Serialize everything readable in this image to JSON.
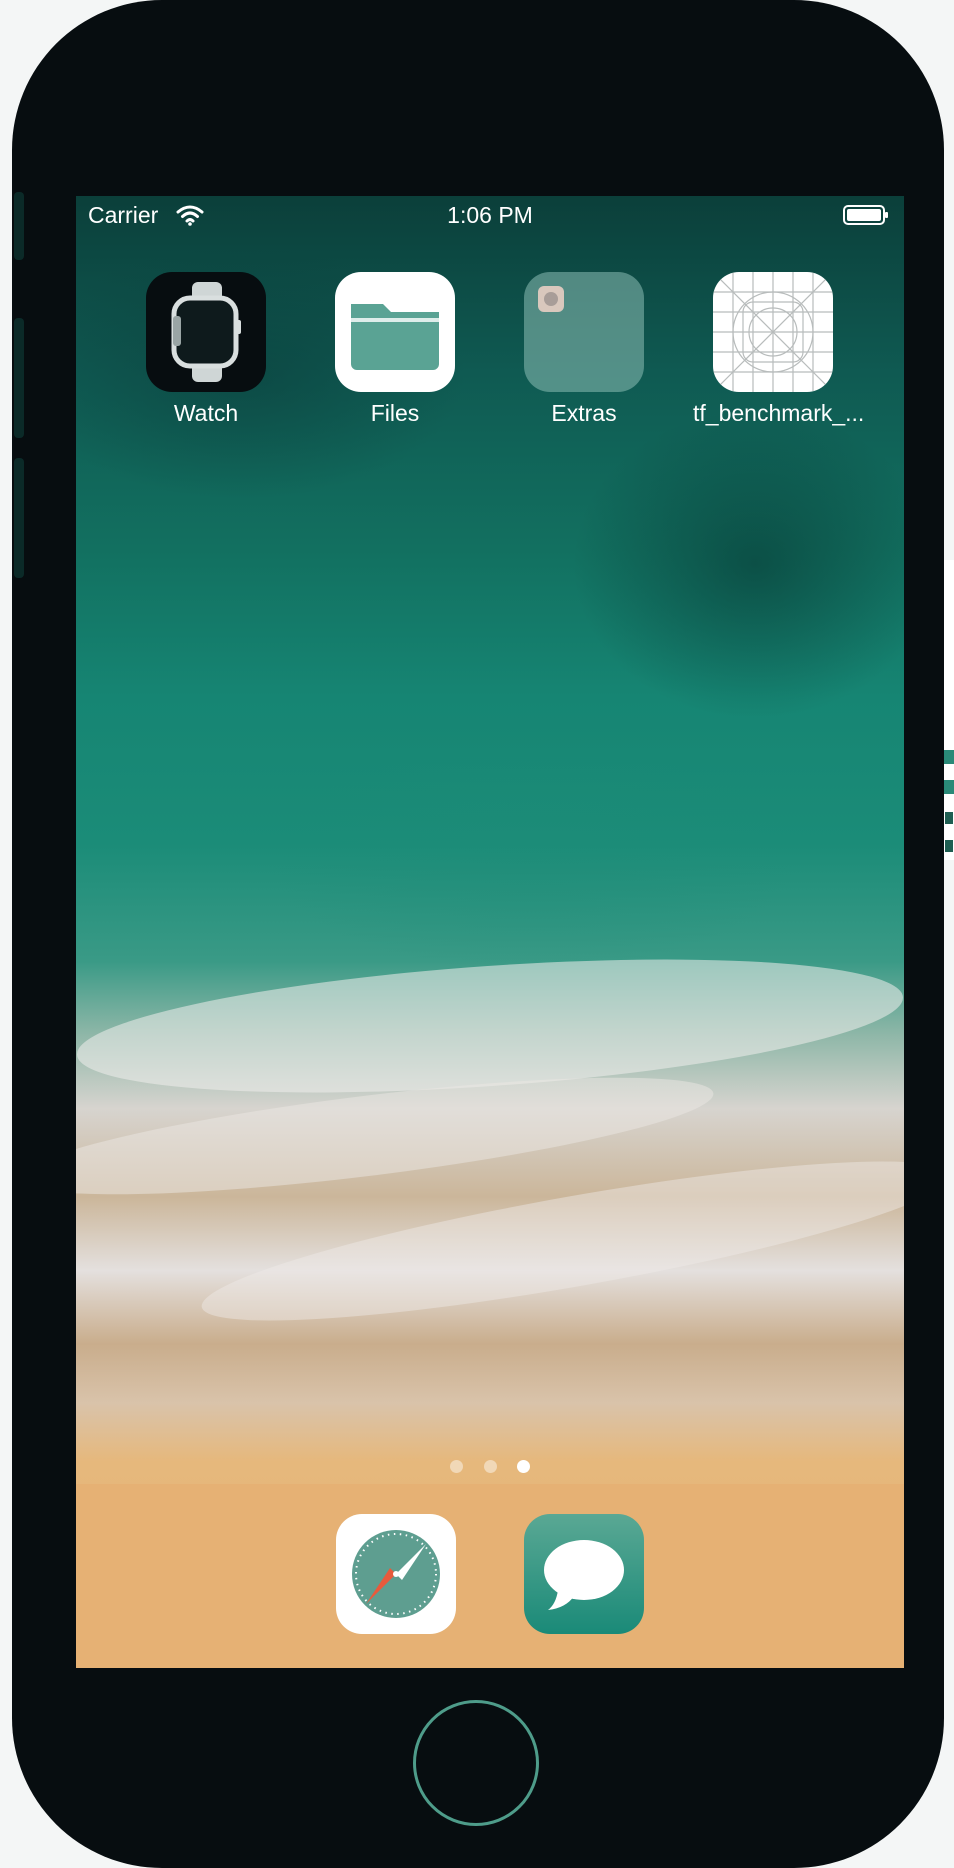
{
  "status_bar": {
    "carrier": "Carrier",
    "time": "1:06 PM",
    "wifi_icon": "wifi-icon",
    "battery_icon": "battery-icon"
  },
  "home_apps": [
    {
      "label": "Watch",
      "icon": "watch-icon"
    },
    {
      "label": "Files",
      "icon": "folder-icon"
    },
    {
      "label": "Extras",
      "icon": "folder-group-icon"
    },
    {
      "label": "tf_benchmark_...",
      "icon": "app-grid-placeholder-icon"
    }
  ],
  "page_indicator": {
    "pages": 3,
    "current": 3
  },
  "dock": [
    {
      "name": "Safari",
      "icon": "compass-icon"
    },
    {
      "name": "Messages",
      "icon": "speech-bubble-icon"
    }
  ],
  "colors": {
    "bezel": "#070d10",
    "accent": "#1a8a78",
    "dock": "#e6b174",
    "sand": "#e6b174"
  }
}
